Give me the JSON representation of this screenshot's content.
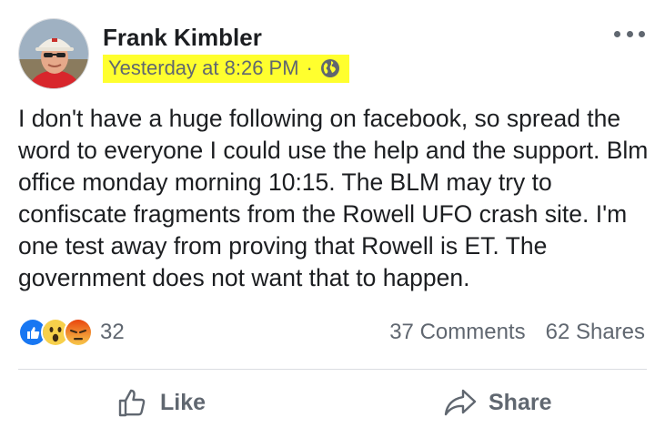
{
  "post": {
    "author": "Frank Kimbler",
    "timestamp": "Yesterday at 8:26 PM",
    "timestamp_separator": "·",
    "visibility_icon": "globe-icon",
    "more_icon": "more-options-icon",
    "text": "I don't have a huge following on facebook, so spread the word to everyone I could use the help and the support. Blm office monday morning 10:15. The BLM may try to confiscate fragments from the Rowell UFO crash site. I'm one test away from proving that Rowell is ET. The government does not want that to happen.",
    "highlight_color": "#ffff2e"
  },
  "reactions": {
    "icons": [
      "like-reaction-icon",
      "wow-reaction-icon",
      "angry-reaction-icon"
    ],
    "count": "32"
  },
  "stats": {
    "comments": "37 Comments",
    "shares": "62 Shares"
  },
  "actions": {
    "like_label": "Like",
    "share_label": "Share"
  },
  "colors": {
    "like_blue": "#1877f2",
    "wow_yellow": "#f7d04b",
    "angry_orange": "#e9710f",
    "secondary_text": "#606770"
  }
}
